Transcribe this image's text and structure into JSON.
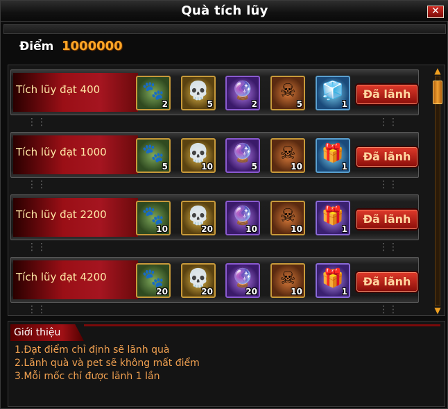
{
  "window": {
    "title": "Quà tích lũy",
    "close_label": "✕"
  },
  "score": {
    "label": "Điểm",
    "value": "1000000"
  },
  "scroll": {
    "up_icon": "▲",
    "down_icon": "▼"
  },
  "tiers": [
    {
      "label": "Tích lũy đạt 400",
      "button": "Đã lãnh",
      "items": [
        {
          "icon": "scroll-creature-icon",
          "qty": "2"
        },
        {
          "icon": "gold-skull-icon",
          "qty": "5"
        },
        {
          "icon": "purple-flame-orb-icon",
          "qty": "2"
        },
        {
          "icon": "skull-chest-icon",
          "qty": "5"
        },
        {
          "icon": "blue-chest-icon",
          "qty": "1"
        }
      ]
    },
    {
      "label": "Tích lũy đạt 1000",
      "button": "Đã lãnh",
      "items": [
        {
          "icon": "scroll-creature-icon",
          "qty": "5"
        },
        {
          "icon": "gold-skull-icon",
          "qty": "10"
        },
        {
          "icon": "purple-flame-orb-icon",
          "qty": "5"
        },
        {
          "icon": "skull-chest-icon",
          "qty": "10"
        },
        {
          "icon": "cyan-chest-icon",
          "qty": "1"
        }
      ]
    },
    {
      "label": "Tích lũy đạt 2200",
      "button": "Đã lãnh",
      "items": [
        {
          "icon": "scroll-creature-icon",
          "qty": "10"
        },
        {
          "icon": "gold-skull-icon",
          "qty": "20"
        },
        {
          "icon": "purple-flame-orb-icon",
          "qty": "10"
        },
        {
          "icon": "skull-chest-icon",
          "qty": "10"
        },
        {
          "icon": "violet-chest-icon",
          "qty": "1"
        }
      ]
    },
    {
      "label": "Tích lũy đạt 4200",
      "button": "Đã lãnh",
      "items": [
        {
          "icon": "scroll-creature-icon",
          "qty": "20"
        },
        {
          "icon": "gold-skull-icon",
          "qty": "20"
        },
        {
          "icon": "purple-flame-orb-icon",
          "qty": "20"
        },
        {
          "icon": "skull-chest-icon",
          "qty": "10"
        },
        {
          "icon": "violet-chest-icon",
          "qty": "1"
        }
      ]
    }
  ],
  "info": {
    "title": "Giới thiệu",
    "lines": [
      "1.Đạt điểm chỉ định sẽ lãnh quà",
      "2.Lãnh quà và pet sẽ không mất điểm",
      "3.Mỗi mốc chỉ được lãnh 1 lần"
    ]
  },
  "colors": {
    "accent": "#ffa626",
    "label_text": "#ffe8a6",
    "button_red": "#c0201a",
    "info_text": "#f0a050"
  }
}
